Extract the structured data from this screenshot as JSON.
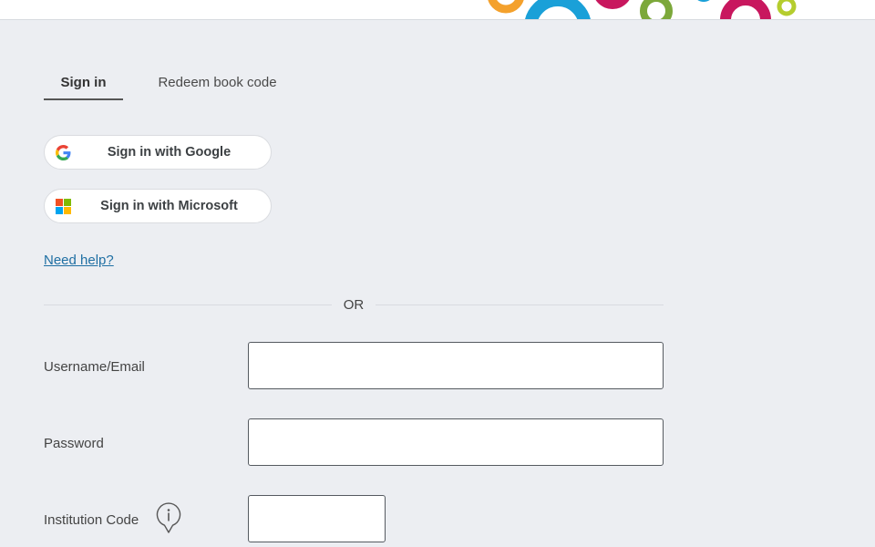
{
  "colors": {
    "background": "#eceef2",
    "link": "#1f6fa3",
    "deco_orange": "#f4a12c",
    "deco_blue": "#1aa0d8",
    "deco_magenta": "#c8175e",
    "deco_green": "#7ca83a",
    "deco_lime": "#b5cd2e"
  },
  "tabs": [
    {
      "label": "Sign in",
      "active": true
    },
    {
      "label": "Redeem book code",
      "active": false
    }
  ],
  "sso": {
    "google_label": "Sign in with Google",
    "google_icon": "google-g-icon",
    "microsoft_label": "Sign in with Microsoft",
    "microsoft_icon": "microsoft-logo-icon"
  },
  "help_link": "Need help?",
  "divider_text": "OR",
  "form": {
    "username_label": "Username/Email",
    "username_value": "",
    "password_label": "Password",
    "password_value": "",
    "institution_label": "Institution Code",
    "institution_value": "",
    "institution_info_icon": "info-icon"
  }
}
